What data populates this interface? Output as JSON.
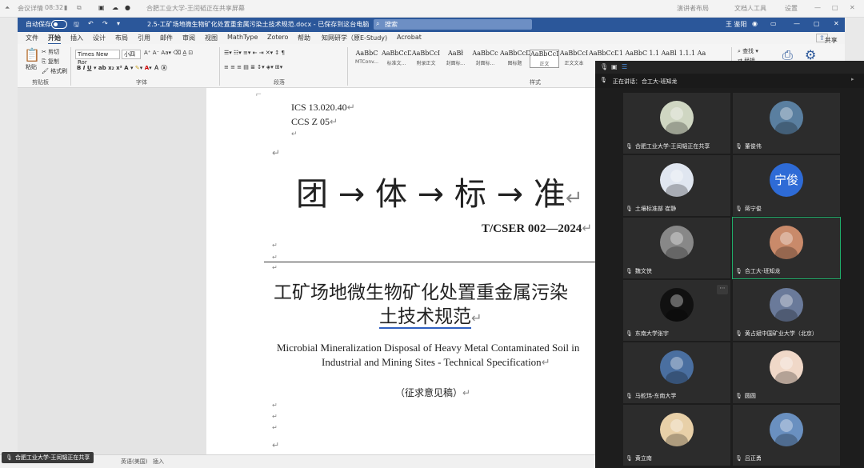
{
  "meeting_top": {
    "app": "会议详情",
    "time": "08:32",
    "share_title": "合肥工业大学-王闰韬正在共享屏幕",
    "whiteboard": "演讲者布局",
    "ai": "文档人工具",
    "settings": "设置"
  },
  "word": {
    "autosave": "自动保存",
    "doc_title": "2.5-工矿场地微生物矿化处置重金属污染土技术规范.docx - 已保存到这台电脑",
    "search_placeholder": "搜索",
    "user": "王 鉴阳",
    "share": "共享",
    "tabs": [
      "文件",
      "开始",
      "插入",
      "设计",
      "布局",
      "引用",
      "邮件",
      "审阅",
      "视图",
      "MathType",
      "Zotero",
      "帮助",
      "知网研学（原E-Study)",
      "Acrobat"
    ],
    "clipboard": {
      "paste": "粘贴",
      "cut": "剪切",
      "copy": "复制",
      "format": "格式刷",
      "label": "剪贴板"
    },
    "font": {
      "name": "Times New Ror",
      "size": "小四",
      "label": "字体"
    },
    "paragraph_label": "段落",
    "styles": [
      {
        "preview": "AaBbC",
        "name": "MTConv..."
      },
      {
        "preview": "AaBbCcDdEe",
        "name": "标准文..."
      },
      {
        "preview": "AaBbCcI",
        "name": "附录正文"
      },
      {
        "preview": "AaBł",
        "name": "封面标..."
      },
      {
        "preview": "AaBbCc",
        "name": "封面标..."
      },
      {
        "preview": "AaBbCcD",
        "name": "图标题"
      },
      {
        "preview": "AaBbCcDc",
        "name": "正文"
      },
      {
        "preview": "AaBbCcI",
        "name": "正文文本"
      },
      {
        "preview": "AaBbCcDc",
        "name": ""
      },
      {
        "preview": "1 AaBbC",
        "name": ""
      },
      {
        "preview": "1.1 AaBl",
        "name": ""
      },
      {
        "preview": "1.1.1 Aa",
        "name": ""
      }
    ],
    "styles_label": "样式",
    "editing": {
      "find": "查找",
      "replace": "替换",
      "select": "选择"
    },
    "status": {
      "lang": "英语(美国)",
      "mode": "插入"
    }
  },
  "doc": {
    "ics": "ICS 13.020.40",
    "ccs": "CCS Z 05",
    "heading": "团 → 体 → 标 → 准",
    "code": "T/CSER 002—2024",
    "title_cn_1": "工矿场地微生物矿化处置重金属污染",
    "title_cn_2": "土技术规范",
    "title_en_1": "Microbial Mineralization Disposal of Heavy Metal Contaminated Soil in",
    "title_en_2": "Industrial and Mining Sites - Technical Specification",
    "draft": "（征求意见稿）"
  },
  "sharing_badge": "合肥工业大学-王闰韬正在共享",
  "meeting": {
    "speaking_label": "正在讲话：",
    "speaking": "合工大-班知龙",
    "participants": [
      {
        "name": "合肥工业大学-王闰韬正在共享",
        "avatar": "photo",
        "color": "#cfd6c2"
      },
      {
        "name": "董俊伟",
        "avatar": "photo",
        "color": "#5a7fa0"
      },
      {
        "name": "土壤标准部 崔静",
        "avatar": "photo",
        "color": "#e0e6f0"
      },
      {
        "name": "蒋宁俊",
        "avatar": "text",
        "text": "宁俊",
        "color": "#2e6bd6"
      },
      {
        "name": "魏文侠",
        "avatar": "photo",
        "color": "#888888"
      },
      {
        "name": "合工大-班知龙",
        "avatar": "photo",
        "color": "#c98a6a"
      },
      {
        "name": "东南大学张宇",
        "avatar": "photo",
        "color": "#111111"
      },
      {
        "name": "黄占斌中国矿业大学（北京）",
        "avatar": "photo",
        "color": "#6a7a9a"
      },
      {
        "name": "马舵玮-东南大学",
        "avatar": "photo",
        "color": "#4a6fa0"
      },
      {
        "name": "圆圆",
        "avatar": "photo",
        "color": "#f0d8c8"
      },
      {
        "name": "黄立南",
        "avatar": "photo",
        "color": "#e8d0a8"
      },
      {
        "name": "吕正勇",
        "avatar": "photo",
        "color": "#6a90c0"
      }
    ]
  }
}
